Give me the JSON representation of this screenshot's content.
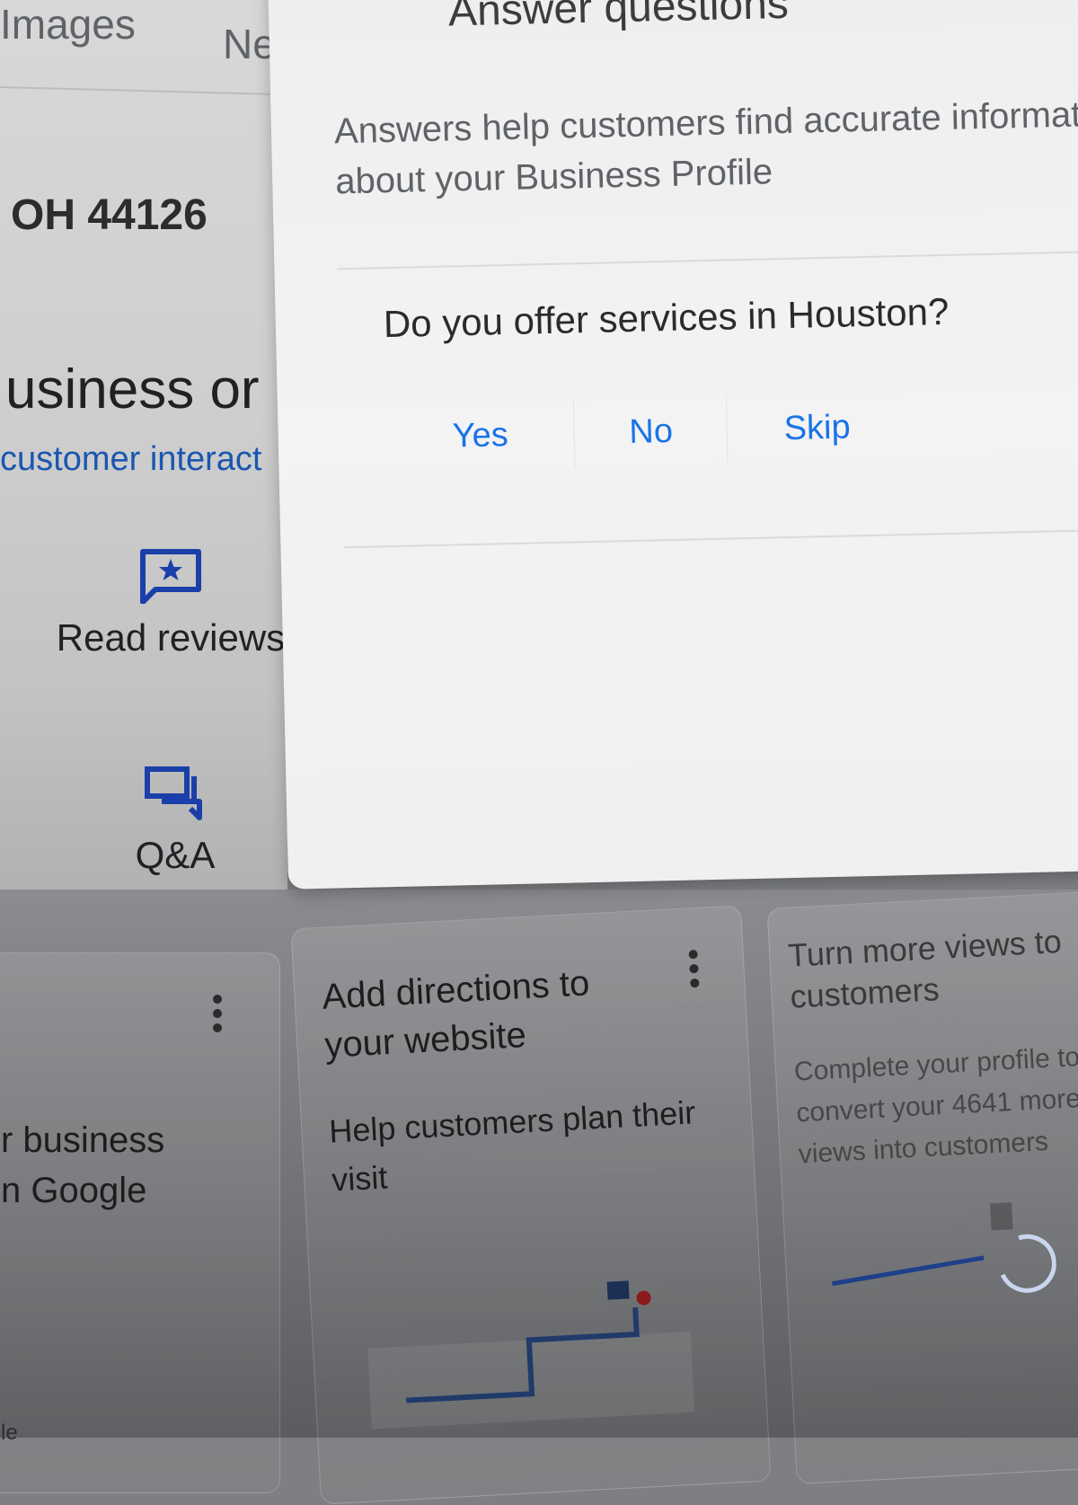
{
  "background": {
    "tabs": [
      "Images",
      "Ne"
    ],
    "address_fragment": "OH 44126",
    "heading_fragment": "usiness or",
    "subheading_fragment": "customer interact",
    "actions": [
      {
        "icon": "review-star-icon",
        "label": "Read reviews"
      },
      {
        "icon": "qa-chat-icon",
        "label": "Q&A"
      }
    ]
  },
  "dialog": {
    "title": "Answer questions",
    "description": "Answers help customers find accurate information about your Business Profile",
    "question": "Do you offer services in Houston?",
    "answers": {
      "yes": "Yes",
      "no": "No",
      "skip": "Skip"
    },
    "answer_color": "#1a73e8"
  },
  "cards": {
    "left": {
      "line1": "r business",
      "line2": "n Google",
      "footer": "oogle"
    },
    "middle": {
      "title": "Add directions to your website",
      "body": "Help customers plan their visit"
    },
    "right": {
      "title": "Turn more views to customers",
      "body": "Complete your profile to convert your 4641 more views into customers"
    }
  }
}
